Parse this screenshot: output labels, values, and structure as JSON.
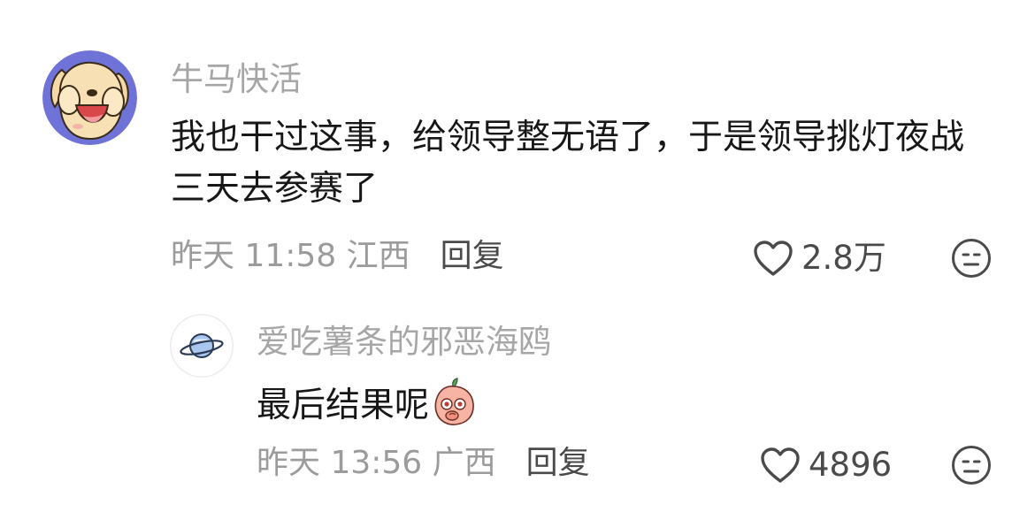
{
  "comment": {
    "avatar_icon": "dog-avatar",
    "username": "牛马快活",
    "text": "我也干过这事，给领导整无语了，于是领导挑灯夜战三天去参赛了",
    "time_location": "昨天 11:58 江西",
    "reply_label": "回复",
    "like_count": "2.8万",
    "accent": "#6f73d8"
  },
  "reply": {
    "avatar_icon": "planet-avatar",
    "username": "爱吃薯条的邪恶海鸥",
    "text": "最后结果呢",
    "emoji_icon": "peach-thinking-emoji",
    "time_location": "昨天 13:56 广西",
    "reply_label": "回复",
    "like_count": "4896"
  }
}
